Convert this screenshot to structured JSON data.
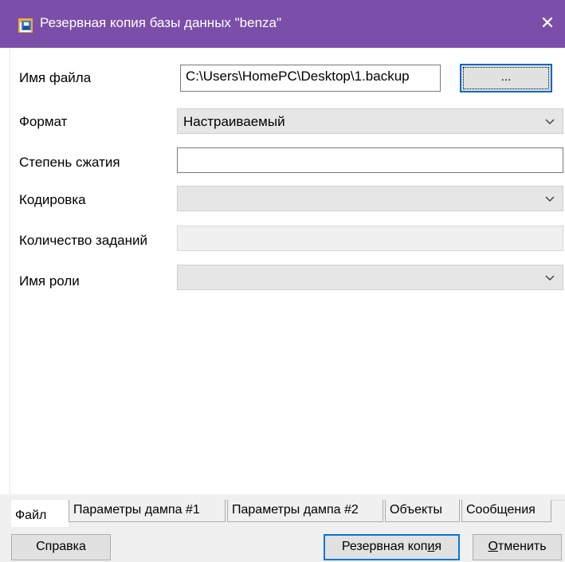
{
  "window": {
    "title": "Резервная копия базы данных \"benza\"",
    "close_symbol": "✕",
    "titlebar_color": "#7b4fa9"
  },
  "form": {
    "filename_label": "Имя файла",
    "filename_value": "C:\\Users\\HomePC\\Desktop\\1.backup",
    "browse_label": "...",
    "format_label": "Формат",
    "format_value": "Настраиваемый",
    "compression_label": "Степень сжатия",
    "compression_value": "",
    "encoding_label": "Кодировка",
    "encoding_value": "",
    "jobs_label": "Количество заданий",
    "jobs_value": "",
    "role_label": "Имя роли",
    "role_value": ""
  },
  "tabs": [
    {
      "label": "Файл",
      "active": true
    },
    {
      "label": "Параметры дампа #1"
    },
    {
      "label": "Параметры дампа #2"
    },
    {
      "label": "Объекты"
    },
    {
      "label": "Сообщения"
    }
  ],
  "buttons": {
    "help": "Справка",
    "backup_pre": "Резервная коп",
    "backup_accel": "и",
    "backup_post": "я",
    "cancel_accel": "О",
    "cancel_rest": "тменить"
  },
  "icons": {
    "app": "database-backup-icon",
    "dropdown": "chevron-down-icon"
  }
}
